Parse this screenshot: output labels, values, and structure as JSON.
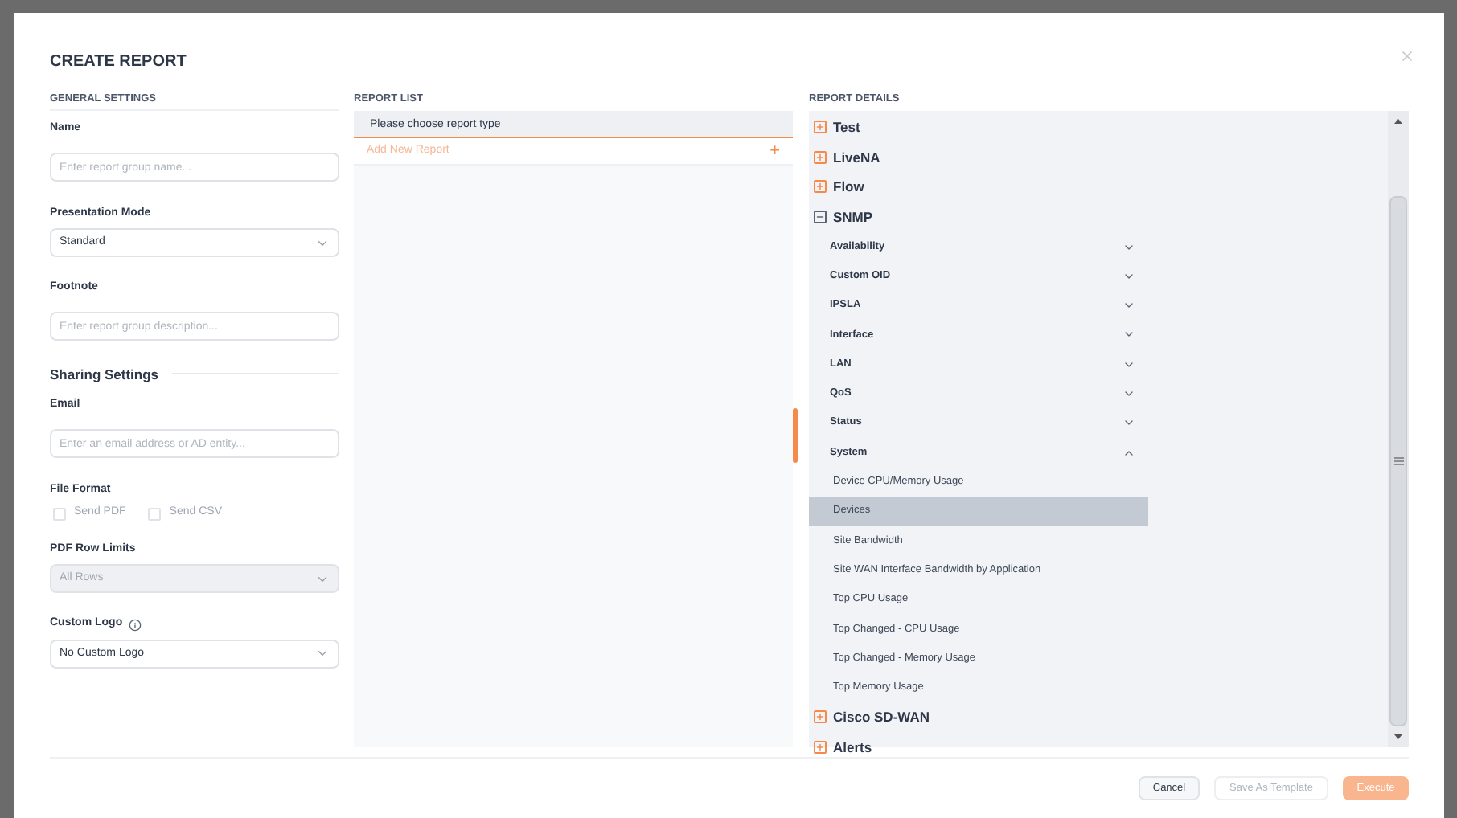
{
  "dialog": {
    "title": "CREATE REPORT"
  },
  "general": {
    "heading": "GENERAL SETTINGS",
    "name": {
      "label": "Name",
      "placeholder": "Enter report group name..."
    },
    "presentation": {
      "label": "Presentation Mode",
      "value": "Standard"
    },
    "footnote": {
      "label": "Footnote",
      "placeholder": "Enter report group description..."
    },
    "sharing_heading": "Sharing Settings",
    "email": {
      "label": "Email",
      "placeholder": "Enter an email address or AD entity..."
    },
    "file_format": {
      "label": "File Format",
      "options": [
        {
          "label": "Send PDF",
          "checked": false
        },
        {
          "label": "Send CSV",
          "checked": false
        }
      ]
    },
    "row_limits": {
      "label": "PDF Row Limits",
      "value": "All Rows",
      "disabled": true
    },
    "custom_logo": {
      "label": "Custom Logo",
      "value": "No Custom Logo"
    }
  },
  "report_list": {
    "heading": "REPORT LIST",
    "prompt": "Please choose report type",
    "add_label": "Add New Report",
    "add_icon": "+"
  },
  "report_details": {
    "heading": "REPORT DETAILS",
    "categories": [
      {
        "label": "Test",
        "expanded": false
      },
      {
        "label": "LiveNA",
        "expanded": false
      },
      {
        "label": "Flow",
        "expanded": false
      },
      {
        "label": "SNMP",
        "expanded": true,
        "children": [
          {
            "label": "Availability",
            "expanded": false
          },
          {
            "label": "Custom OID",
            "expanded": false
          },
          {
            "label": "IPSLA",
            "expanded": false
          },
          {
            "label": "Interface",
            "expanded": false
          },
          {
            "label": "LAN",
            "expanded": false
          },
          {
            "label": "QoS",
            "expanded": false
          },
          {
            "label": "Status",
            "expanded": false
          },
          {
            "label": "System",
            "expanded": true,
            "children": [
              {
                "label": "Device CPU/Memory Usage",
                "selected": false
              },
              {
                "label": "Devices",
                "selected": true
              },
              {
                "label": "Site Bandwidth",
                "selected": false
              },
              {
                "label": "Site WAN Interface Bandwidth by Application",
                "selected": false
              },
              {
                "label": "Top CPU Usage",
                "selected": false
              },
              {
                "label": "Top Changed - CPU Usage",
                "selected": false
              },
              {
                "label": "Top Changed - Memory Usage",
                "selected": false
              },
              {
                "label": "Top Memory Usage",
                "selected": false
              }
            ]
          }
        ]
      },
      {
        "label": "Cisco SD-WAN",
        "expanded": false
      },
      {
        "label": "Alerts",
        "expanded": false
      }
    ]
  },
  "buttons": [
    {
      "label": "Cancel",
      "kind": "secondary"
    },
    {
      "label": "Save As Template",
      "kind": "disabled"
    },
    {
      "label": "Execute",
      "kind": "primary"
    }
  ]
}
